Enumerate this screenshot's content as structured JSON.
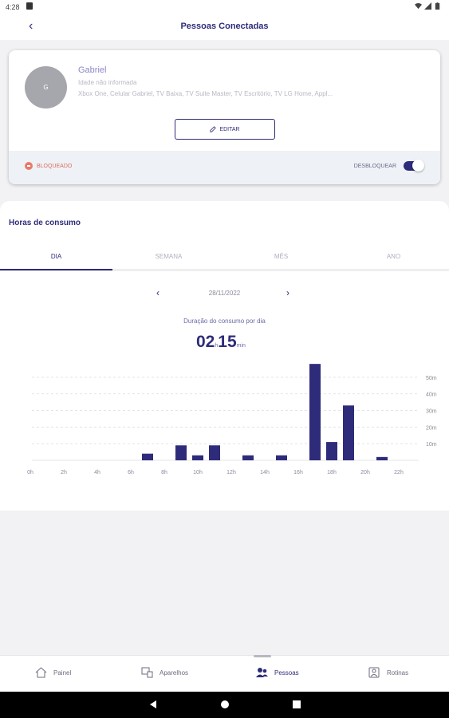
{
  "status_bar": {
    "time": "4:28"
  },
  "app_bar": {
    "title": "Pessoas Conectadas"
  },
  "profile": {
    "initial": "G",
    "name": "Gabriel",
    "age": "Idade não informada",
    "devices": "Xbox One, Celular Gabriel, TV Baixa, TV Suite Master, TV Escritório, TV LG Home, Appl...",
    "edit_label": "EDITAR",
    "status_label": "BLOQUEADO",
    "unlock_label": "DESBLOQUEAR",
    "unlock_toggle_on": true
  },
  "consumption": {
    "title": "Horas de consumo",
    "tabs": [
      "DIA",
      "SEMANA",
      "MÊS",
      "ANO"
    ],
    "active_tab": "DIA",
    "date": "28/11/2022",
    "subtitle": "Duração do consumo por dia",
    "total_hours": "02",
    "total_hours_unit": "h",
    "total_minutes": "15",
    "total_minutes_unit": "min"
  },
  "chart_data": {
    "type": "bar",
    "categories": [
      "0h",
      "1h",
      "2h",
      "3h",
      "4h",
      "5h",
      "6h",
      "7h",
      "8h",
      "9h",
      "10h",
      "11h",
      "12h",
      "13h",
      "14h",
      "15h",
      "16h",
      "17h",
      "18h",
      "19h",
      "20h",
      "21h",
      "22h"
    ],
    "values": [
      0,
      0,
      0,
      0,
      0,
      0,
      0,
      4,
      0,
      9,
      3,
      9,
      0,
      3,
      0,
      3,
      0,
      58,
      11,
      33,
      0,
      2,
      0
    ],
    "x_tick_labels": [
      "0h",
      "2h",
      "4h",
      "6h",
      "8h",
      "10h",
      "12h",
      "14h",
      "16h",
      "18h",
      "20h",
      "22h"
    ],
    "y_tick_labels": [
      "10m",
      "20m",
      "30m",
      "40m",
      "50m"
    ],
    "y_ticks": [
      10,
      20,
      30,
      40,
      50
    ],
    "ylim": [
      0,
      60
    ],
    "bar_color": "#2e2c7a",
    "grid": true
  },
  "bottom_nav": {
    "items": [
      {
        "label": "Painel",
        "icon": "home-icon"
      },
      {
        "label": "Aparelhos",
        "icon": "devices-icon"
      },
      {
        "label": "Pessoas",
        "icon": "people-icon"
      },
      {
        "label": "Rotinas",
        "icon": "routine-icon"
      }
    ],
    "active": "Pessoas"
  },
  "colors": {
    "primary": "#2e2c7a",
    "blocked": "#e06a5a",
    "avatar": "#a6a6ad"
  }
}
